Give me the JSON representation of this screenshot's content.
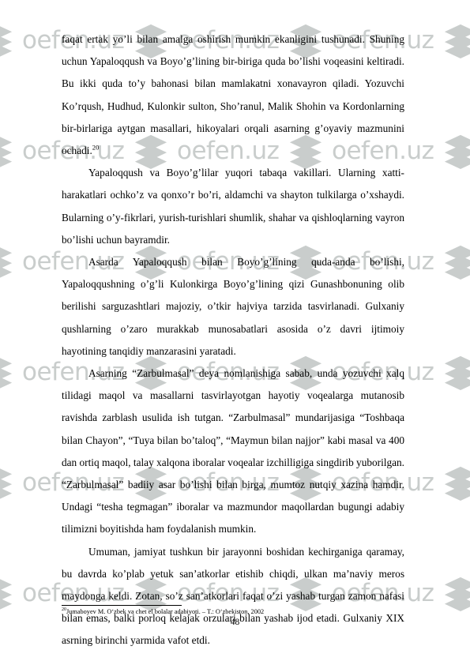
{
  "document": {
    "page_number": "48",
    "watermark": {
      "text": "oefen.uz",
      "icon": "layers-chevron-icon",
      "color": "#c9cdcc"
    },
    "paragraphs": [
      {
        "id": "p1",
        "text": "faqat ertak yo’li bilan amalga oshirish mumkin ekanligini tushunadi. Shuning uchun Yapaloqqush va Boyo’g’lining bir-biriga quda bo’lishi voqeasini keltiradi. Bu ikki quda to’y bahonasi bilan mamlakatni xonavayron qiladi. Yozuvchi Ko’rqush, Hudhud, Kulonkir sulton, Sho’ranul, Malik Shohin va Kordonlarning bir-birlariga aytgan masallari, hikoyalari orqali asarning g’oyaviy mazmunini ochadi.",
        "footnote_marker": "20",
        "first": true
      },
      {
        "id": "p2",
        "text": "Yapaloqqush va Boyo’g’lilar yuqori tabaqa vakillari. Ularning xatti-harakatlari ochko’z va qonxo’r bo’ri, aldamchi va shayton tulkilarga o’xshaydi. Bularning o’y-fikrlari, yurish-turishlari shumlik, shahar va qishloqlarning vayron bo’lishi uchun bayramdir.",
        "footnote_marker": "",
        "first": false
      },
      {
        "id": "p3",
        "text": "Asarda Yapaloqqush bilan Boyo’g’lining quda-anda bo’lishi, Yapaloqqushning o’g’li Kulonkirga Boyo’g’lining qizi Gunashbonuning olib berilishi sarguzashtlari majoziy, o’tkir hajviya tarzida tasvirlanadi. Gulxaniy qushlarning o’zaro murakkab munosabatlari asosida o’z davri ijtimoiy hayotining tanqidiy manzarasini yaratadi.",
        "footnote_marker": "",
        "first": false
      },
      {
        "id": "p4",
        "text": "Asarning “Zarbulmasal” deya nomlanishiga sabab, unda yozuvchi xalq tilidagi maqol va masallarni tasvirlayotgan hayotiy voqealarga mutanosib ravishda zarblash usulida ish tutgan. “Zarbulmasal” mundarijasiga “Toshbaqa bilan Chayon”, “Tuya bilan bo’taloq”, “Maymun bilan najjor” kabi masal va 400 dan ortiq maqol, talay  xalqona iboralar voqealar izchilligiga singdirib yuborilgan. “Zarbulmasal” badiiy asar bo’lishi bilan birga, mumtoz nutqiy xazina hamdir. Undagi “tesha tegmagan” iboralar va mazmundor maqollardan bugungi adabiy tilimizni boyitishda ham foydalanish mumkin.",
        "footnote_marker": "",
        "first": false
      },
      {
        "id": "p5",
        "text": "Umuman, jamiyat tushkun bir jarayonni boshidan kechirganiga qaramay, bu davrda ko’plab yetuk san’atkorlar etishib chiqdi, ulkan ma’naviy meros maydonga keldi. Zotan, so’z san’atkorlari faqat o’zi yashab turgan zamon nafasi bilan emas, balki porloq kelajak orzulari bilan yashab ijod etadi. Gulxaniy XIX asrning birinchi yarmida vafot etdi.",
        "footnote_marker": "",
        "first": false
      }
    ],
    "footnote": {
      "marker": "20",
      "text": "Jumaboyev M.  O‘zbek va chet el bolalar adabiyoti. – T.: O‘zbekiston, 2002"
    }
  }
}
